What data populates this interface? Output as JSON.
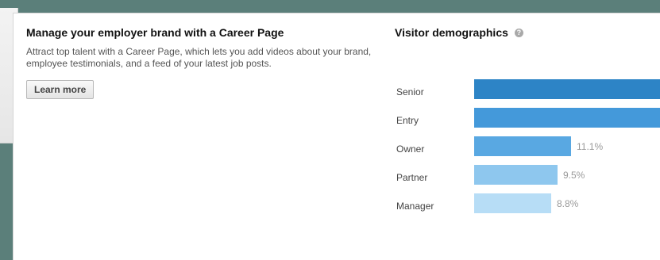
{
  "promo": {
    "heading": "Manage your employer brand with a Career Page",
    "description": "Attract top talent with a Career Page, which lets you add videos about your brand, employee testimonials, and a feed of your latest job posts.",
    "learn_more_label": "Learn more"
  },
  "demographics": {
    "title": "Visitor demographics",
    "help_icon": "question-circle-icon",
    "rows": [
      {
        "label": "Senior",
        "percent_text": "",
        "value": 100,
        "color": "#2d84c6"
      },
      {
        "label": "Entry",
        "percent_text": "",
        "value": 100,
        "color": "#4499da"
      },
      {
        "label": "Owner",
        "percent_text": "11.1%",
        "value": 11.1,
        "color": "#59a8e2"
      },
      {
        "label": "Partner",
        "percent_text": "9.5%",
        "value": 9.5,
        "color": "#8ec7ee"
      },
      {
        "label": "Manager",
        "percent_text": "8.8%",
        "value": 8.8,
        "color": "#b7ddf6"
      }
    ]
  }
}
